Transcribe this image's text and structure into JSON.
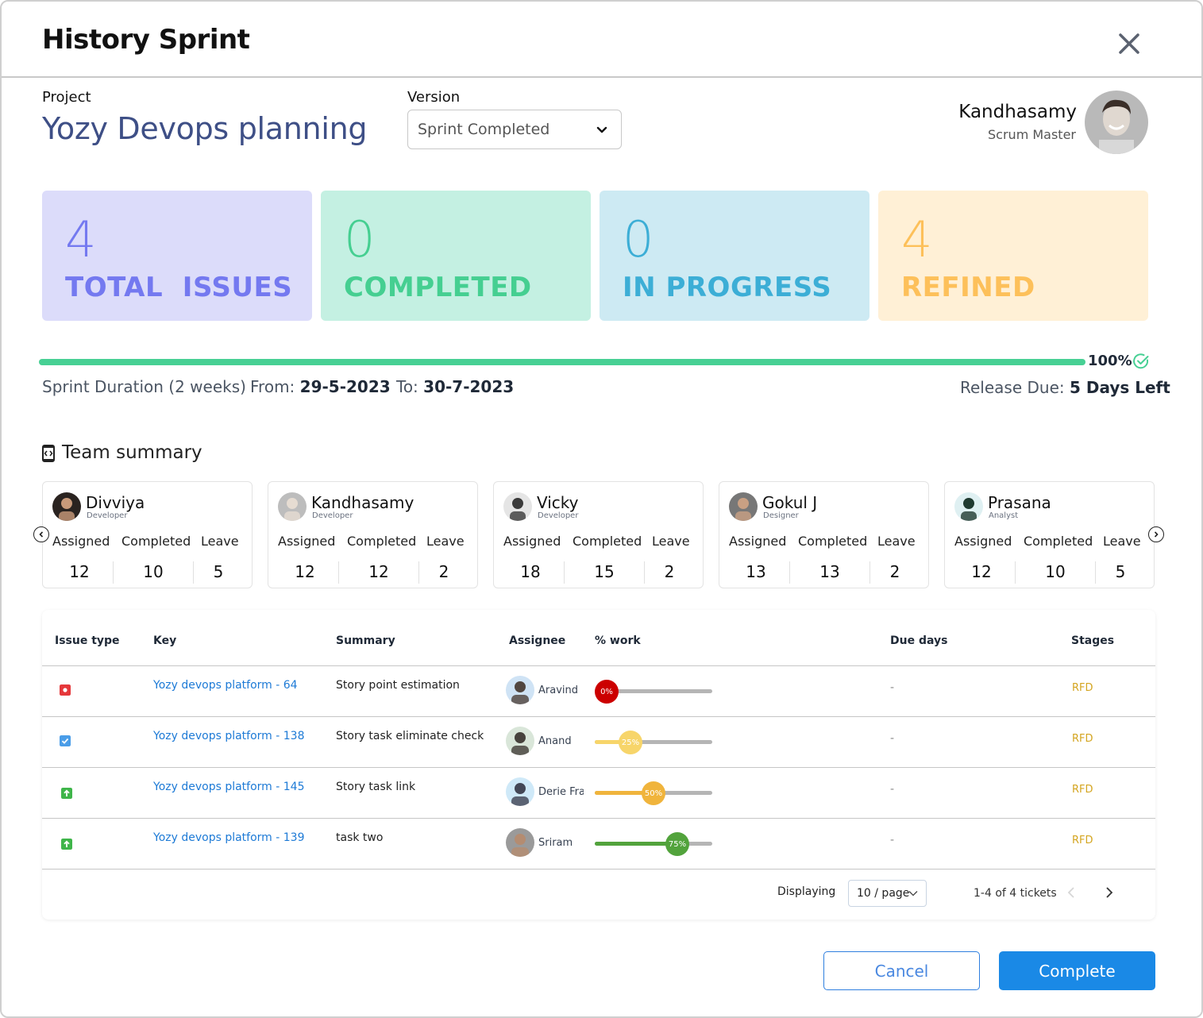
{
  "modal": {
    "title": "History Sprint",
    "close_icon": "close-icon"
  },
  "project": {
    "label": "Project",
    "name": "Yozy Devops planning"
  },
  "version": {
    "label": "Version",
    "selected": "Sprint Completed"
  },
  "scrum_master": {
    "name": "Kandhasamy",
    "role": "Scrum Master"
  },
  "stats": [
    {
      "value": "4",
      "label": "TOTAL  ISSUES",
      "bg": "#dcdcfa",
      "color": "#7479f0"
    },
    {
      "value": "0",
      "label": "COMPLETED",
      "bg": "#c4f0e2",
      "color": "#45cf91"
    },
    {
      "value": "0",
      "label": "IN PROGRESS",
      "bg": "#cdeaf3",
      "color": "#3caed6"
    },
    {
      "value": "4",
      "label": "REFINED",
      "bg": "#fff0d6",
      "color": "#fdc05a"
    }
  ],
  "sprint_progress": {
    "percent": 100,
    "percent_label": "100%",
    "duration_label": "Sprint Duration (2 weeks)",
    "from_label": "From:",
    "from_value": "29-5-2023",
    "to_label": "To:",
    "to_value": "30-7-2023",
    "release_label": "Release Due:",
    "release_value": "5 Days Left"
  },
  "team_summary": {
    "title": "Team summary",
    "col_assigned": "Assigned",
    "col_completed": "Completed",
    "col_leave": "Leave",
    "members": [
      {
        "name": "Divviya",
        "role": "Developer",
        "assigned": "12",
        "completed": "10",
        "leave": "5"
      },
      {
        "name": "Kandhasamy",
        "role": "Developer",
        "assigned": "12",
        "completed": "12",
        "leave": "2"
      },
      {
        "name": "Vicky",
        "role": "Developer",
        "assigned": "18",
        "completed": "15",
        "leave": "2"
      },
      {
        "name": "Gokul J",
        "role": "Designer",
        "assigned": "13",
        "completed": "13",
        "leave": "2"
      },
      {
        "name": "Prasana",
        "role": "Analyst",
        "assigned": "12",
        "completed": "10",
        "leave": "5"
      }
    ]
  },
  "table": {
    "headers": [
      "Issue type",
      "Key",
      "Summary",
      "Assignee",
      "% work",
      "Due days",
      "Stages"
    ],
    "rows": [
      {
        "type": "bug",
        "type_color": "#e5383b",
        "key": "Yozy devops platform - 64",
        "summary": "Story point estimation",
        "assignee": "Aravind",
        "work": 0,
        "work_label": "0%",
        "work_color": "#cc0000",
        "due": "-",
        "stage": "RFD"
      },
      {
        "type": "task",
        "type_color": "#4a9de8",
        "key": "Yozy devops platform - 138",
        "summary": "Story task eliminate check",
        "assignee": "Anand",
        "work": 25,
        "work_label": "25%",
        "work_color": "#f7d56a",
        "due": "-",
        "stage": "RFD"
      },
      {
        "type": "improvement",
        "type_color": "#3fb54a",
        "key": "Yozy devops platform - 145",
        "summary": "Story task link",
        "assignee": "Derie Frar",
        "work": 50,
        "work_label": "50%",
        "work_color": "#f0b43c",
        "due": "-",
        "stage": "RFD"
      },
      {
        "type": "improvement",
        "type_color": "#3fb54a",
        "key": "Yozy devops platform - 139",
        "summary": "task two",
        "assignee": "Sriram",
        "work": 75,
        "work_label": "75%",
        "work_color": "#52a33c",
        "due": "-",
        "stage": "RFD"
      }
    ],
    "pagination": {
      "label": "Displaying",
      "page_size": "10 / page",
      "info": "1-4 of 4 tickets"
    }
  },
  "actions": {
    "cancel": "Cancel",
    "complete": "Complete"
  }
}
